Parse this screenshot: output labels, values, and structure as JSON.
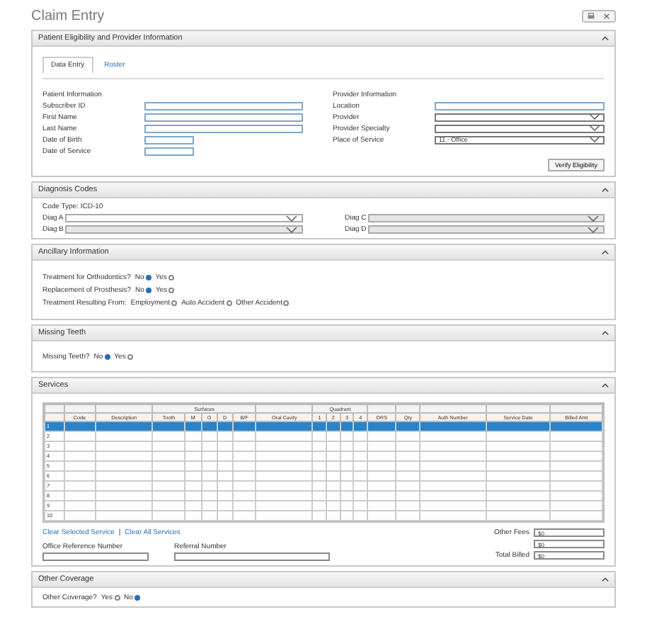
{
  "title": "Claim Entry",
  "eligibility": {
    "heading": "Patient Eligibility and Provider Information",
    "tabs": [
      {
        "label": "Data Entry",
        "selected": true
      },
      {
        "label": "Roster",
        "selected": false
      }
    ],
    "patient": {
      "heading": "Patient Information",
      "fields": [
        {
          "label": "Subscriber ID",
          "kind": "wide"
        },
        {
          "label": "First Name",
          "kind": "wide"
        },
        {
          "label": "Last Name",
          "kind": "wide"
        },
        {
          "label": "Date of Birth",
          "kind": "short"
        },
        {
          "label": "Date of Service",
          "kind": "short"
        }
      ]
    },
    "provider": {
      "heading": "Provider Information",
      "fields": [
        {
          "label": "Location",
          "kind": "input"
        },
        {
          "label": "Provider",
          "kind": "select"
        },
        {
          "label": "Provider Specialty",
          "kind": "select"
        },
        {
          "label": "Place of Service",
          "kind": "select",
          "value": "11 - Office"
        }
      ]
    },
    "button": "Verify Eligibility"
  },
  "diagnosis": {
    "heading": "Diagnosis Codes",
    "code_type": "Code Type: ICD-10",
    "fields": [
      {
        "label": "Diag A",
        "disabled": false
      },
      {
        "label": "Diag C",
        "disabled": true
      },
      {
        "label": "Diag B",
        "disabled": true
      },
      {
        "label": "Diag D",
        "disabled": true
      }
    ]
  },
  "ancillary": {
    "heading": "Ancillary Information",
    "questions": [
      {
        "label": "Treatment for Orthodontics?",
        "options": [
          {
            "label": "No",
            "selected": true
          },
          {
            "label": "Yes",
            "selected": false
          }
        ]
      },
      {
        "label": "Replacement of Prosthesis?",
        "options": [
          {
            "label": "No",
            "selected": true
          },
          {
            "label": "Yes",
            "selected": false
          }
        ]
      },
      {
        "label": "Treatment Resulting From:",
        "options": [
          {
            "label": "Employment",
            "selected": false
          },
          {
            "label": "Auto Accident",
            "selected": false
          },
          {
            "label": "Other Accident",
            "selected": false
          }
        ]
      }
    ]
  },
  "missing_teeth": {
    "heading": "Missing Teeth",
    "questions": [
      {
        "label": "Missing Teeth?",
        "options": [
          {
            "label": "No",
            "selected": true
          },
          {
            "label": "Yes",
            "selected": false
          }
        ]
      }
    ]
  },
  "services": {
    "heading": "Services",
    "columns": [
      {
        "label": "Code"
      },
      {
        "label": "Description"
      },
      {
        "group": "Surfaces",
        "columns": [
          {
            "label": "Tooth"
          },
          {
            "label": "M"
          },
          {
            "label": "O"
          },
          {
            "label": "D"
          },
          {
            "label": "B/F"
          }
        ]
      },
      {
        "label": "Oral Cavity"
      },
      {
        "group": "Quadrant",
        "columns": [
          {
            "label": "1"
          },
          {
            "label": "2"
          },
          {
            "label": "3"
          },
          {
            "label": "4"
          }
        ]
      },
      {
        "label": "DRS"
      },
      {
        "label": "Qty"
      },
      {
        "label": "Auth Number"
      },
      {
        "label": "Service Date"
      },
      {
        "label": "Billed Amt"
      }
    ],
    "rows": [
      {
        "number": "1",
        "selected": true
      },
      {
        "number": "2",
        "selected": false
      },
      {
        "number": "3",
        "selected": false
      },
      {
        "number": "4",
        "selected": false
      },
      {
        "number": "5",
        "selected": false
      },
      {
        "number": "6",
        "selected": false
      },
      {
        "number": "7",
        "selected": false
      },
      {
        "number": "8",
        "selected": false
      },
      {
        "number": "9",
        "selected": false
      },
      {
        "number": "10",
        "selected": false
      }
    ],
    "links": [
      "Clear Selected Service",
      "Clear All Services"
    ],
    "link_separator": "|",
    "reference_fields": [
      "Office Reference Number",
      "Referral Number"
    ],
    "totals": [
      {
        "label": "Other Fees",
        "value": "$0"
      },
      {
        "value": "$0"
      },
      {
        "label": "Total Billed",
        "value": "$0"
      }
    ]
  },
  "other_coverage": {
    "heading": "Other Coverage",
    "questions": [
      {
        "label": "Other Coverage?",
        "options": [
          {
            "label": "Yes",
            "selected": false
          },
          {
            "label": "No",
            "selected": true
          }
        ]
      }
    ]
  }
}
